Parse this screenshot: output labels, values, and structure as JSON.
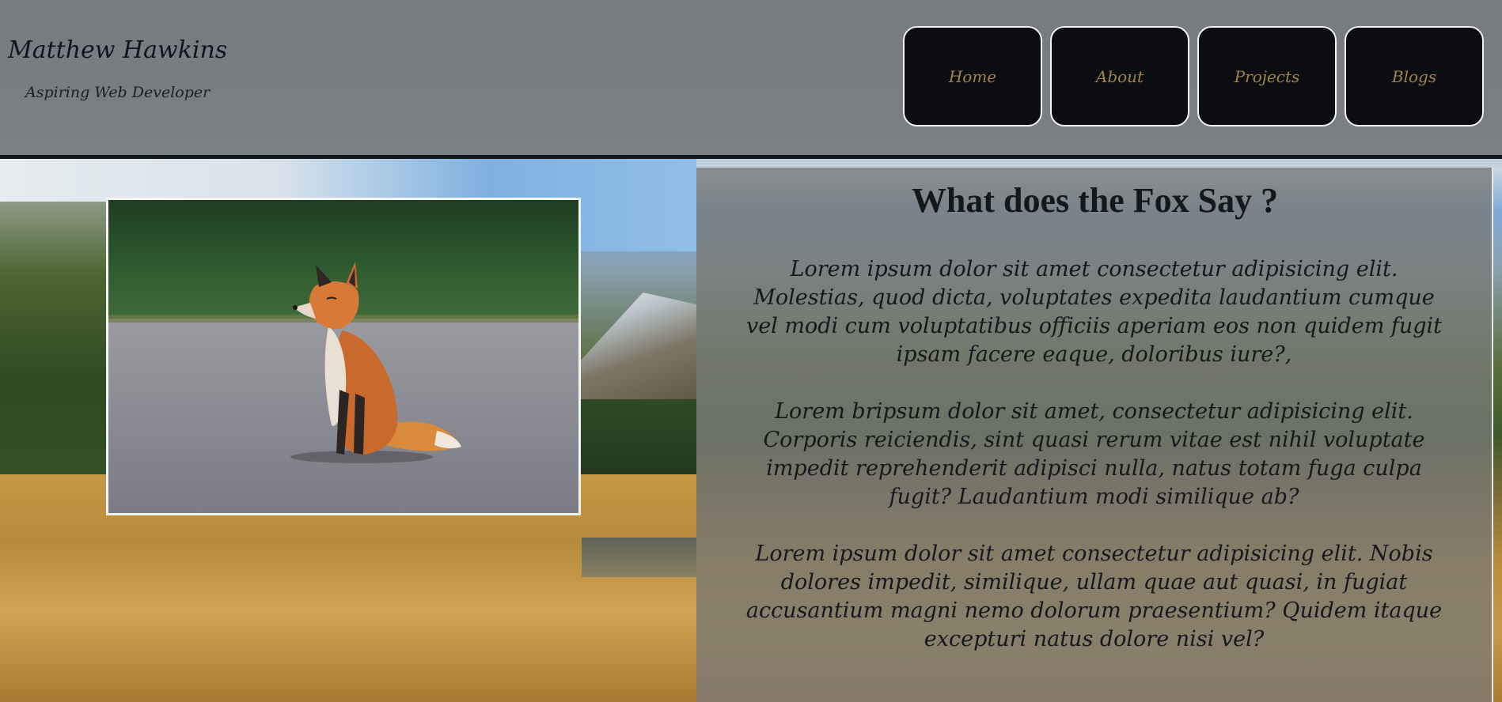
{
  "header": {
    "name": "Matthew Hawkins",
    "tagline": "Aspiring Web Developer"
  },
  "nav": {
    "items": [
      {
        "label": "Home"
      },
      {
        "label": "About"
      },
      {
        "label": "Projects"
      },
      {
        "label": "Blogs"
      }
    ]
  },
  "article": {
    "title": "What does the Fox Say ?",
    "paragraphs": [
      "Lorem ipsum dolor sit amet consectetur adipisicing elit. Molestias, quod dicta, voluptates expedita laudantium cumque vel modi cum voluptatibus officiis aperiam eos non quidem fugit ipsam facere eaque, doloribus iure?,",
      "Lorem bripsum dolor sit amet, consectetur adipisicing elit. Corporis reiciendis, sint quasi rerum vitae est nihil voluptate impedit reprehenderit adipisci nulla, natus totam fuga culpa fugit? Laudantium modi similique ab?",
      "Lorem ipsum dolor sit amet consectetur adipisicing elit. Nobis dolores impedit, similique, ullam quae aut quasi, in fugiat accusantium magni nemo dolorum praesentium? Quidem itaque excepturi natus dolore nisi vel?"
    ]
  },
  "image": {
    "subject": "fox-photo"
  },
  "colors": {
    "nav_background": "#0b0d10",
    "nav_text": "#a18447",
    "header_background": "#787c80"
  }
}
